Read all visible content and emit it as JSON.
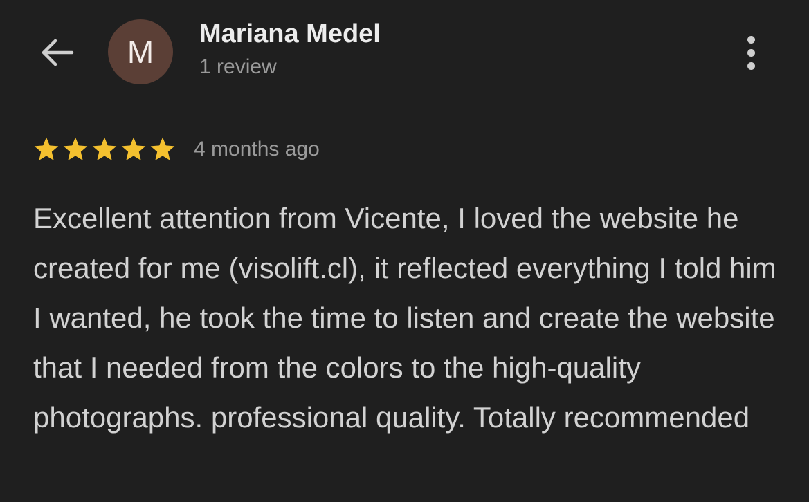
{
  "header": {
    "avatar_initial": "M",
    "reviewer_name": "Mariana Medel",
    "review_count": "1 review",
    "back_icon": "arrow-left-icon",
    "more_icon": "more-vertical-icon"
  },
  "review": {
    "rating": 5,
    "rating_max": 5,
    "time": "4 months ago",
    "text": "Excellent attention from Vicente, I loved the website he created for me (visolift.cl), it reflected everything I told him I wanted, he took the time to listen and create the website that I needed from the colors to the high-quality photographs. professional quality. Totally recommended"
  },
  "colors": {
    "background": "#1f1f1f",
    "star": "#f4c02f",
    "avatar": "#5b3f36",
    "name": "#ececec",
    "secondary_text": "#9a9a9a",
    "body_text": "#d2d2d2"
  }
}
